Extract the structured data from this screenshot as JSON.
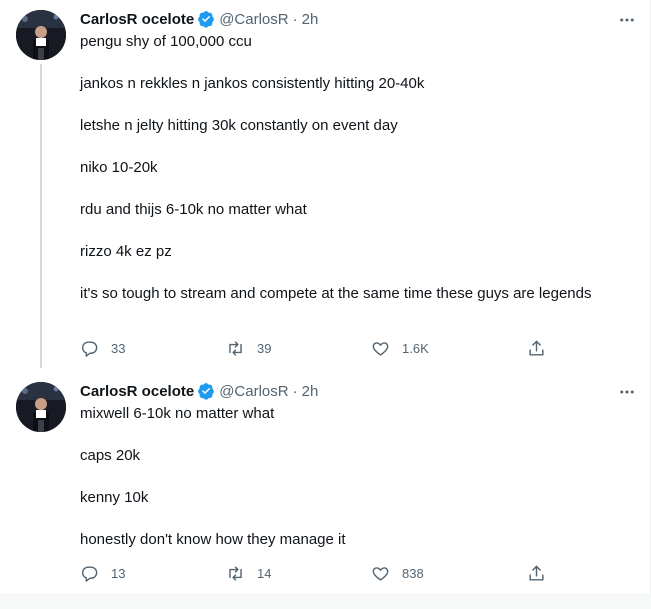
{
  "theme": {
    "accent": "#1d9bf0",
    "text": "#0f1419",
    "muted": "#536471",
    "border": "#eff3f4"
  },
  "tweets": [
    {
      "author": {
        "name": "CarlosR ocelote",
        "handle": "@CarlosR",
        "verified": true,
        "avatar_icon": "avatar-photo"
      },
      "separator": "·",
      "time": "2h",
      "paragraphs": [
        "pengu shy of 100,000 ccu",
        "jankos n rekkles n jankos consistently hitting 20-40k",
        "letshe n jelty hitting 30k constantly on event day",
        "niko 10-20k",
        "rdu and thijs 6-10k no matter what",
        "rizzo 4k ez pz",
        "it's so tough to stream and compete at the same time these guys are legends"
      ],
      "actions": {
        "replies": "33",
        "retweets": "39",
        "likes": "1.6K"
      }
    },
    {
      "author": {
        "name": "CarlosR ocelote",
        "handle": "@CarlosR",
        "verified": true,
        "avatar_icon": "avatar-photo"
      },
      "separator": "·",
      "time": "2h",
      "paragraphs": [
        "mixwell 6-10k no matter what",
        "caps 20k",
        "kenny 10k",
        "honestly don't know how they manage it"
      ],
      "actions": {
        "replies": "13",
        "retweets": "14",
        "likes": "838"
      }
    }
  ]
}
